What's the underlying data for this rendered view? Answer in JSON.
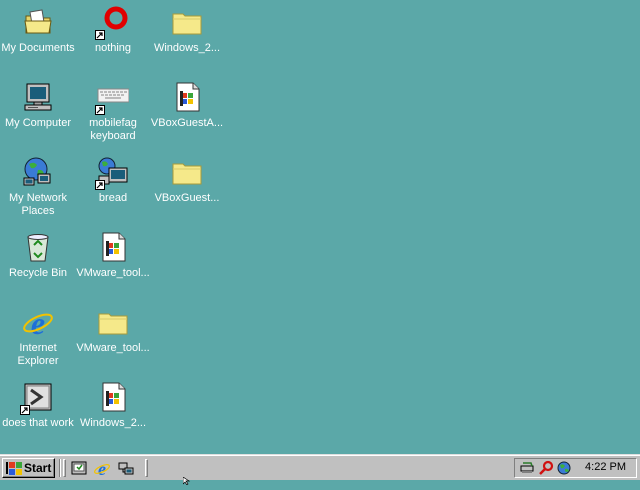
{
  "desktop_icons": {
    "my_documents": "My Documents",
    "nothing": "nothing",
    "windows_2_a": "Windows_2...",
    "my_computer": "My Computer",
    "mobilefag_keyboard": "mobilefag keyboard",
    "vbox_guest_a": "VBoxGuestA...",
    "my_network_places": "My Network Places",
    "bread": "bread",
    "vbox_guest": "VBoxGuest...",
    "recycle_bin": "Recycle Bin",
    "vmware_tool_a": "VMware_tool...",
    "internet_explorer": "Internet Explorer",
    "vmware_tool_b": "VMware_tool...",
    "does_that_work": "does that work",
    "windows_2_b": "Windows_2..."
  },
  "taskbar": {
    "start_label": "Start",
    "clock": "4:22 PM"
  },
  "colors": {
    "desktop": "#5ba8a8",
    "taskbar": "#c0c0c0",
    "folder": "#f5e98a"
  }
}
